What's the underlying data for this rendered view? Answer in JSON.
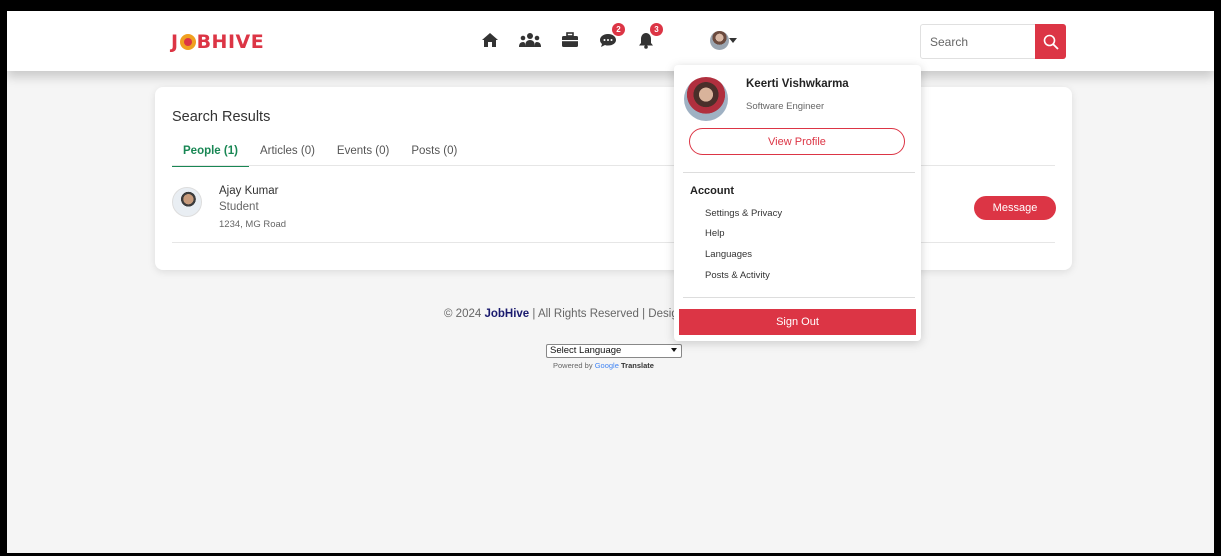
{
  "brand": {
    "logo_text_left": "J",
    "logo_text_right": "BHIVE"
  },
  "nav": {
    "icons": [
      {
        "name": "home-icon"
      },
      {
        "name": "network-icon"
      },
      {
        "name": "jobs-icon"
      },
      {
        "name": "messages-icon",
        "badge": "2"
      },
      {
        "name": "notifications-icon",
        "badge": "3"
      },
      {
        "name": "profile-avatar"
      }
    ]
  },
  "search": {
    "placeholder": "Search",
    "value": ""
  },
  "results": {
    "title": "Search Results",
    "tabs": [
      {
        "label": "People (1)",
        "active": true
      },
      {
        "label": "Articles (0)",
        "active": false
      },
      {
        "label": "Events (0)",
        "active": false
      },
      {
        "label": "Posts (0)",
        "active": false
      }
    ],
    "people": [
      {
        "name": "Ajay Kumar",
        "role": "Student",
        "address": "1234, MG Road",
        "action": "Message"
      }
    ]
  },
  "footer": {
    "prefix": "© 2024 ",
    "brand": "JobHive",
    "suffix": " | All Rights Reserved | Desig",
    "language_select": "Select Language",
    "powered_by": "Powered by ",
    "google": "Google",
    "translate": "Translate"
  },
  "profile_menu": {
    "name": "Keerti Vishwkarma",
    "role": "Software Engineer",
    "view_profile": "View Profile",
    "account_heading": "Account",
    "items": [
      "Settings & Privacy",
      "Help",
      "Languages",
      "Posts & Activity"
    ],
    "sign_out": "Sign Out"
  },
  "colors": {
    "accent": "#dc3545",
    "tab_active": "#198754"
  }
}
